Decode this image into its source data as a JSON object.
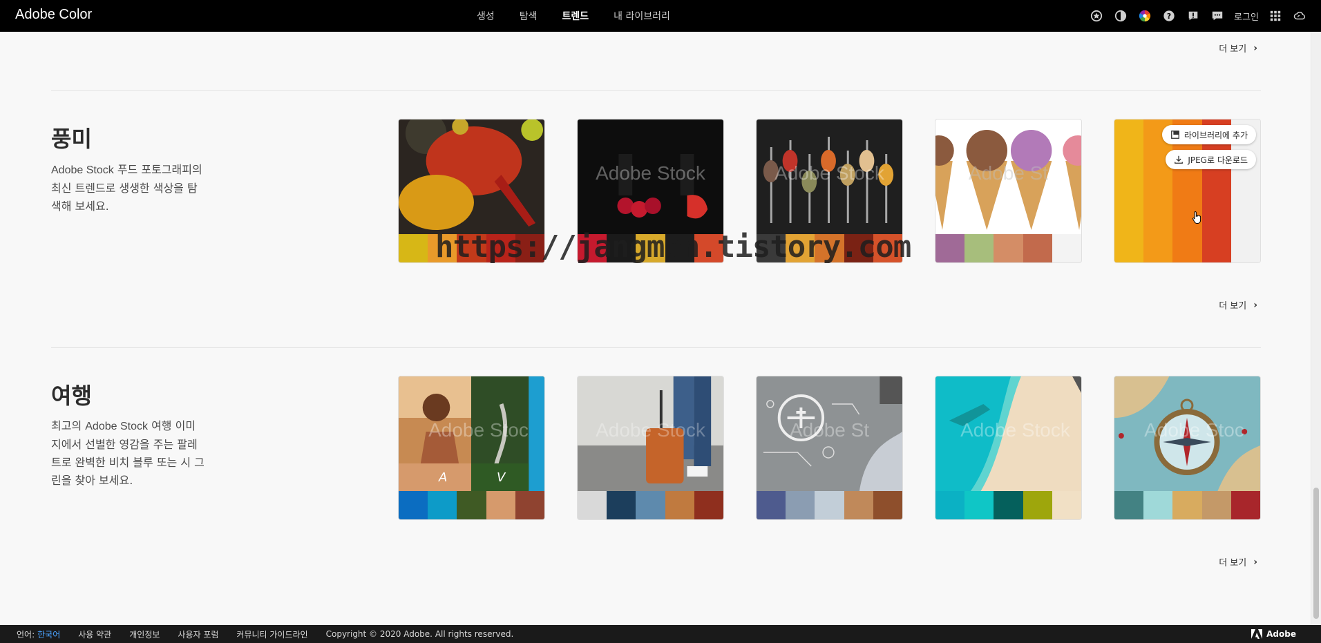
{
  "app": {
    "title": "Adobe Color"
  },
  "nav": {
    "items": [
      {
        "label": "생성"
      },
      {
        "label": "탐색"
      },
      {
        "label": "트렌드"
      },
      {
        "label": "내 라이브러리"
      }
    ]
  },
  "header": {
    "login": "로그인",
    "icons": [
      "star-icon",
      "contrast-icon",
      "color-wheel-icon",
      "help-icon",
      "feedback-icon",
      "chat-icon",
      "apps-grid-icon",
      "creative-cloud-icon"
    ]
  },
  "more_label": "더 보기",
  "sections": [
    {
      "title": "풍미",
      "desc_parts": [
        "Adobe Stock",
        " 푸드 포토그래피의 최신 트렌드로 생생한 색상을 탐색해 보세요."
      ],
      "cards": [
        {
          "watermark": "",
          "palette": [
            "#d7b716",
            "#e99a2a",
            "#c23a1a",
            "#b8231a",
            "#8a1f16"
          ]
        },
        {
          "watermark": "Adobe Stock",
          "palette": [
            "#c51a2e",
            "#1a1a1a",
            "#d7a92b",
            "#1d1d1d",
            "#d4492a"
          ]
        },
        {
          "watermark": "Adobe Stock",
          "palette": [
            "#3a3a3a",
            "#e2a334",
            "#d4732a",
            "#7a2214",
            "#d5522a"
          ]
        },
        {
          "watermark": "Adobe St",
          "palette": [
            "#a06a97",
            "#a7be7c",
            "#d48d66",
            "#c26a4c",
            "#f3f3f3"
          ]
        },
        {
          "palette": [
            "#f0b519",
            "#f39a18",
            "#f07b15",
            "#d73f22",
            "#f1f1f1"
          ],
          "actions": [
            "라이브러리에 추가",
            "JPEG로 다운로드"
          ]
        }
      ]
    },
    {
      "title": "여행",
      "desc_parts": [
        "최고의 ",
        "Adobe Stock",
        " 여행 이미지에서 선별한 영감을 주는 팔레트로 완벽한 비치 블루 또는 시 그린을 찾아 보세요."
      ],
      "cards": [
        {
          "watermark": "Adobe Stoc",
          "tiles": [
            "A",
            "V"
          ],
          "palette": [
            "#0b6dc1",
            "#0d9bc8",
            "#3f5a24",
            "#d69a6c",
            "#8f4330"
          ]
        },
        {
          "watermark": "Adobe Stock",
          "palette": [
            "#d9d9d9",
            "#1c3e5c",
            "#5e8aad",
            "#c07a3f",
            "#8f2f1e"
          ]
        },
        {
          "watermark": "Adobe St",
          "palette": [
            "#4e5b8e",
            "#8b9db2",
            "#c2ced8",
            "#c0895a",
            "#8e4f2c"
          ]
        },
        {
          "watermark": "Adobe Stock",
          "palette": [
            "#0bb1c4",
            "#0fc6c6",
            "#05605c",
            "#9ea60c",
            "#f1e0c5"
          ]
        },
        {
          "watermark": "Adobe Stoc",
          "palette": [
            "#438283",
            "#9fd9d9",
            "#d8ab5f",
            "#c49968",
            "#a8262b"
          ]
        }
      ]
    }
  ],
  "overlay_text": "https://jangman.tistory.com",
  "footer": {
    "lang_label": "언어:",
    "lang_value": "한국어",
    "links": [
      "사용 약관",
      "개인정보",
      "사용자 포럼",
      "커뮤니티 가이드라인"
    ],
    "copyright": "Copyright © 2020 Adobe. All rights reserved.",
    "brand": "Adobe"
  }
}
